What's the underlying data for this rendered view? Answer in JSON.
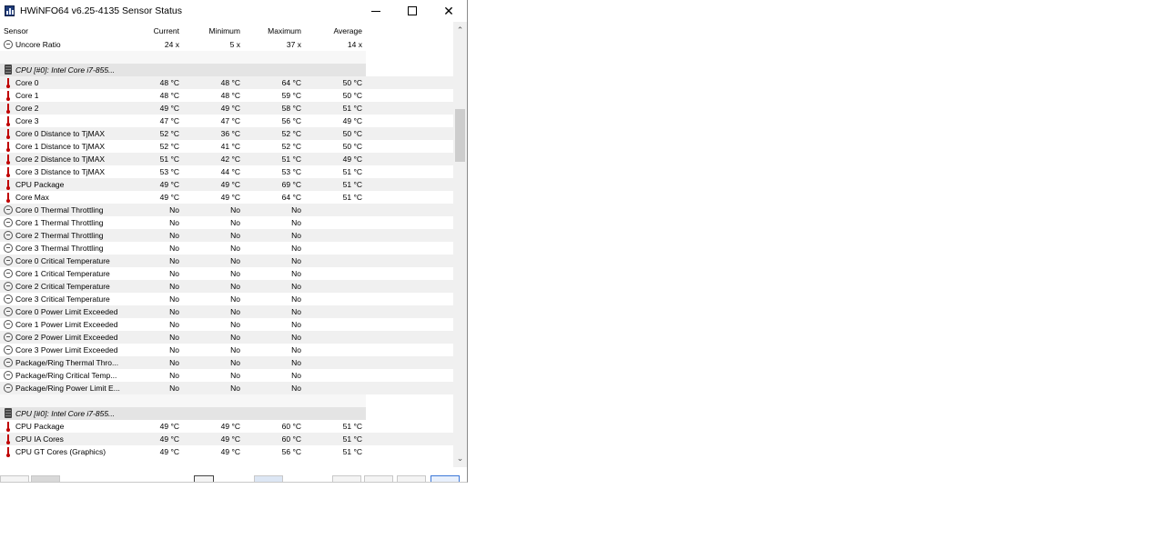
{
  "window": {
    "title": "HWiNFO64 v6.25-4135 Sensor Status",
    "close_glyph": "✕"
  },
  "columns": [
    "Sensor",
    "Current",
    "Minimum",
    "Maximum",
    "Average"
  ],
  "rows": [
    {
      "kind": "item",
      "icon": "gauge-icon",
      "name": "Uncore Ratio",
      "cur": "24 x",
      "min": "5 x",
      "max": "37 x",
      "avg": "14 x"
    },
    {
      "kind": "blank"
    },
    {
      "kind": "group",
      "icon": "cpu-chip-icon",
      "name": "CPU [#0]: Intel Core i7-855..."
    },
    {
      "kind": "item",
      "icon": "thermometer-icon",
      "name": "Core 0",
      "cur": "48 °C",
      "min": "48 °C",
      "max": "64 °C",
      "avg": "50 °C"
    },
    {
      "kind": "item",
      "icon": "thermometer-icon",
      "name": "Core 1",
      "cur": "48 °C",
      "min": "48 °C",
      "max": "59 °C",
      "avg": "50 °C"
    },
    {
      "kind": "item",
      "icon": "thermometer-icon",
      "name": "Core 2",
      "cur": "49 °C",
      "min": "49 °C",
      "max": "58 °C",
      "avg": "51 °C"
    },
    {
      "kind": "item",
      "icon": "thermometer-icon",
      "name": "Core 3",
      "cur": "47 °C",
      "min": "47 °C",
      "max": "56 °C",
      "avg": "49 °C"
    },
    {
      "kind": "item",
      "icon": "thermometer-icon",
      "name": "Core 0 Distance to TjMAX",
      "cur": "52 °C",
      "min": "36 °C",
      "max": "52 °C",
      "avg": "50 °C"
    },
    {
      "kind": "item",
      "icon": "thermometer-icon",
      "name": "Core 1 Distance to TjMAX",
      "cur": "52 °C",
      "min": "41 °C",
      "max": "52 °C",
      "avg": "50 °C"
    },
    {
      "kind": "item",
      "icon": "thermometer-icon",
      "name": "Core 2 Distance to TjMAX",
      "cur": "51 °C",
      "min": "42 °C",
      "max": "51 °C",
      "avg": "49 °C"
    },
    {
      "kind": "item",
      "icon": "thermometer-icon",
      "name": "Core 3 Distance to TjMAX",
      "cur": "53 °C",
      "min": "44 °C",
      "max": "53 °C",
      "avg": "51 °C"
    },
    {
      "kind": "item",
      "icon": "thermometer-icon",
      "name": "CPU Package",
      "cur": "49 °C",
      "min": "49 °C",
      "max": "69 °C",
      "avg": "51 °C"
    },
    {
      "kind": "item",
      "icon": "thermometer-icon",
      "name": "Core Max",
      "cur": "49 °C",
      "min": "49 °C",
      "max": "64 °C",
      "avg": "51 °C"
    },
    {
      "kind": "item",
      "icon": "gauge-icon",
      "name": "Core 0 Thermal Throttling",
      "cur": "No",
      "min": "No",
      "max": "No",
      "avg": ""
    },
    {
      "kind": "item",
      "icon": "gauge-icon",
      "name": "Core 1 Thermal Throttling",
      "cur": "No",
      "min": "No",
      "max": "No",
      "avg": ""
    },
    {
      "kind": "item",
      "icon": "gauge-icon",
      "name": "Core 2 Thermal Throttling",
      "cur": "No",
      "min": "No",
      "max": "No",
      "avg": ""
    },
    {
      "kind": "item",
      "icon": "gauge-icon",
      "name": "Core 3 Thermal Throttling",
      "cur": "No",
      "min": "No",
      "max": "No",
      "avg": ""
    },
    {
      "kind": "item",
      "icon": "gauge-icon",
      "name": "Core 0 Critical Temperature",
      "cur": "No",
      "min": "No",
      "max": "No",
      "avg": ""
    },
    {
      "kind": "item",
      "icon": "gauge-icon",
      "name": "Core 1 Critical Temperature",
      "cur": "No",
      "min": "No",
      "max": "No",
      "avg": ""
    },
    {
      "kind": "item",
      "icon": "gauge-icon",
      "name": "Core 2 Critical Temperature",
      "cur": "No",
      "min": "No",
      "max": "No",
      "avg": ""
    },
    {
      "kind": "item",
      "icon": "gauge-icon",
      "name": "Core 3 Critical Temperature",
      "cur": "No",
      "min": "No",
      "max": "No",
      "avg": ""
    },
    {
      "kind": "item",
      "icon": "gauge-icon",
      "name": "Core 0 Power Limit Exceeded",
      "cur": "No",
      "min": "No",
      "max": "No",
      "avg": ""
    },
    {
      "kind": "item",
      "icon": "gauge-icon",
      "name": "Core 1 Power Limit Exceeded",
      "cur": "No",
      "min": "No",
      "max": "No",
      "avg": ""
    },
    {
      "kind": "item",
      "icon": "gauge-icon",
      "name": "Core 2 Power Limit Exceeded",
      "cur": "No",
      "min": "No",
      "max": "No",
      "avg": ""
    },
    {
      "kind": "item",
      "icon": "gauge-icon",
      "name": "Core 3 Power Limit Exceeded",
      "cur": "No",
      "min": "No",
      "max": "No",
      "avg": ""
    },
    {
      "kind": "item",
      "icon": "gauge-icon",
      "name": "Package/Ring Thermal Thro...",
      "cur": "No",
      "min": "No",
      "max": "No",
      "avg": ""
    },
    {
      "kind": "item",
      "icon": "gauge-icon",
      "name": "Package/Ring Critical Temp...",
      "cur": "No",
      "min": "No",
      "max": "No",
      "avg": ""
    },
    {
      "kind": "item",
      "icon": "gauge-icon",
      "name": "Package/Ring Power Limit E...",
      "cur": "No",
      "min": "No",
      "max": "No",
      "avg": ""
    },
    {
      "kind": "blank"
    },
    {
      "kind": "group",
      "icon": "cpu-chip-icon",
      "name": "CPU [#0]: Intel Core i7-855..."
    },
    {
      "kind": "item",
      "icon": "thermometer-icon",
      "name": "CPU Package",
      "cur": "49 °C",
      "min": "49 °C",
      "max": "60 °C",
      "avg": "51 °C"
    },
    {
      "kind": "item",
      "icon": "thermometer-icon",
      "name": "CPU IA Cores",
      "cur": "49 °C",
      "min": "49 °C",
      "max": "60 °C",
      "avg": "51 °C"
    },
    {
      "kind": "item",
      "icon": "thermometer-icon",
      "name": "CPU GT Cores (Graphics)",
      "cur": "49 °C",
      "min": "49 °C",
      "max": "56 °C",
      "avg": "51 °C"
    }
  ],
  "scrollbar": {
    "up_glyph": "⌃",
    "down_glyph": "⌄"
  },
  "colors": {
    "temp_icon": "#c00000",
    "group_row": "#e4e4e4",
    "alt_row": "#f0f0f0"
  }
}
